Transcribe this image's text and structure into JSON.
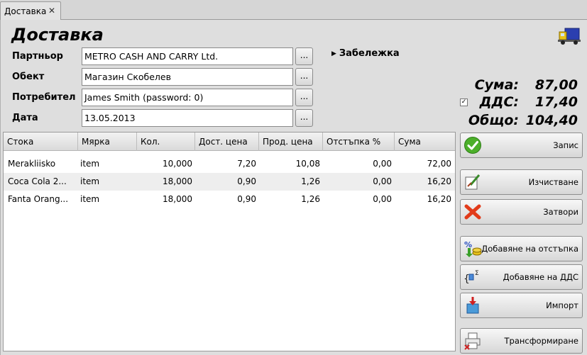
{
  "tab": {
    "label": "Доставка",
    "close": "✕"
  },
  "title": "Доставка",
  "form": {
    "partner_label": "Партньор",
    "partner_value": "METRO CASH AND CARRY Ltd.",
    "object_label": "Обект",
    "object_value": "Магазин Скобелев",
    "user_label": "Потребител",
    "user_value": "James Smith (password: 0)",
    "date_label": "Дата",
    "date_value": "13.05.2013",
    "browse": "..."
  },
  "note_label": "Забележка",
  "totals": {
    "sum_label": "Сума:",
    "sum_value": "87,00",
    "vat_label": "ДДС:",
    "vat_value": "17,40",
    "vat_checked": true,
    "total_label": "Общо:",
    "total_value": "104,40"
  },
  "table": {
    "columns": [
      "Стока",
      "Мярка",
      "Кол.",
      "Дост. цена",
      "Прод. цена",
      "Отстъпка %",
      "Сума"
    ],
    "rows": [
      [
        "Merakliisko",
        "item",
        "10,000",
        "7,20",
        "10,08",
        "0,00",
        "72,00"
      ],
      [
        "Coca Cola 2...",
        "item",
        "18,000",
        "0,90",
        "1,26",
        "0,00",
        "16,20"
      ],
      [
        "Fanta Orang...",
        "item",
        "18,000",
        "0,90",
        "1,26",
        "0,00",
        "16,20"
      ]
    ]
  },
  "buttons": {
    "save": "Запис",
    "clear": "Изчистване",
    "close": "Затвори",
    "add_discount": "Добавяне на отстъпка",
    "add_vat": "Добавяне на ДДС",
    "import": "Импорт",
    "transform": "Трансформиране"
  },
  "icons": {
    "truck": "truck-icon",
    "save": "checkmark-icon",
    "clear": "eraser-icon",
    "close": "red-x-icon",
    "discount": "percent-coins-icon",
    "vat": "sigma-icon",
    "import": "import-box-icon",
    "transform": "printer-icon"
  },
  "colors": {
    "background": "#dedede",
    "field_bg": "#ffffff",
    "alt_row": "#eeeeee",
    "save_green": "#4caf2a",
    "close_red": "#e23b1a"
  }
}
